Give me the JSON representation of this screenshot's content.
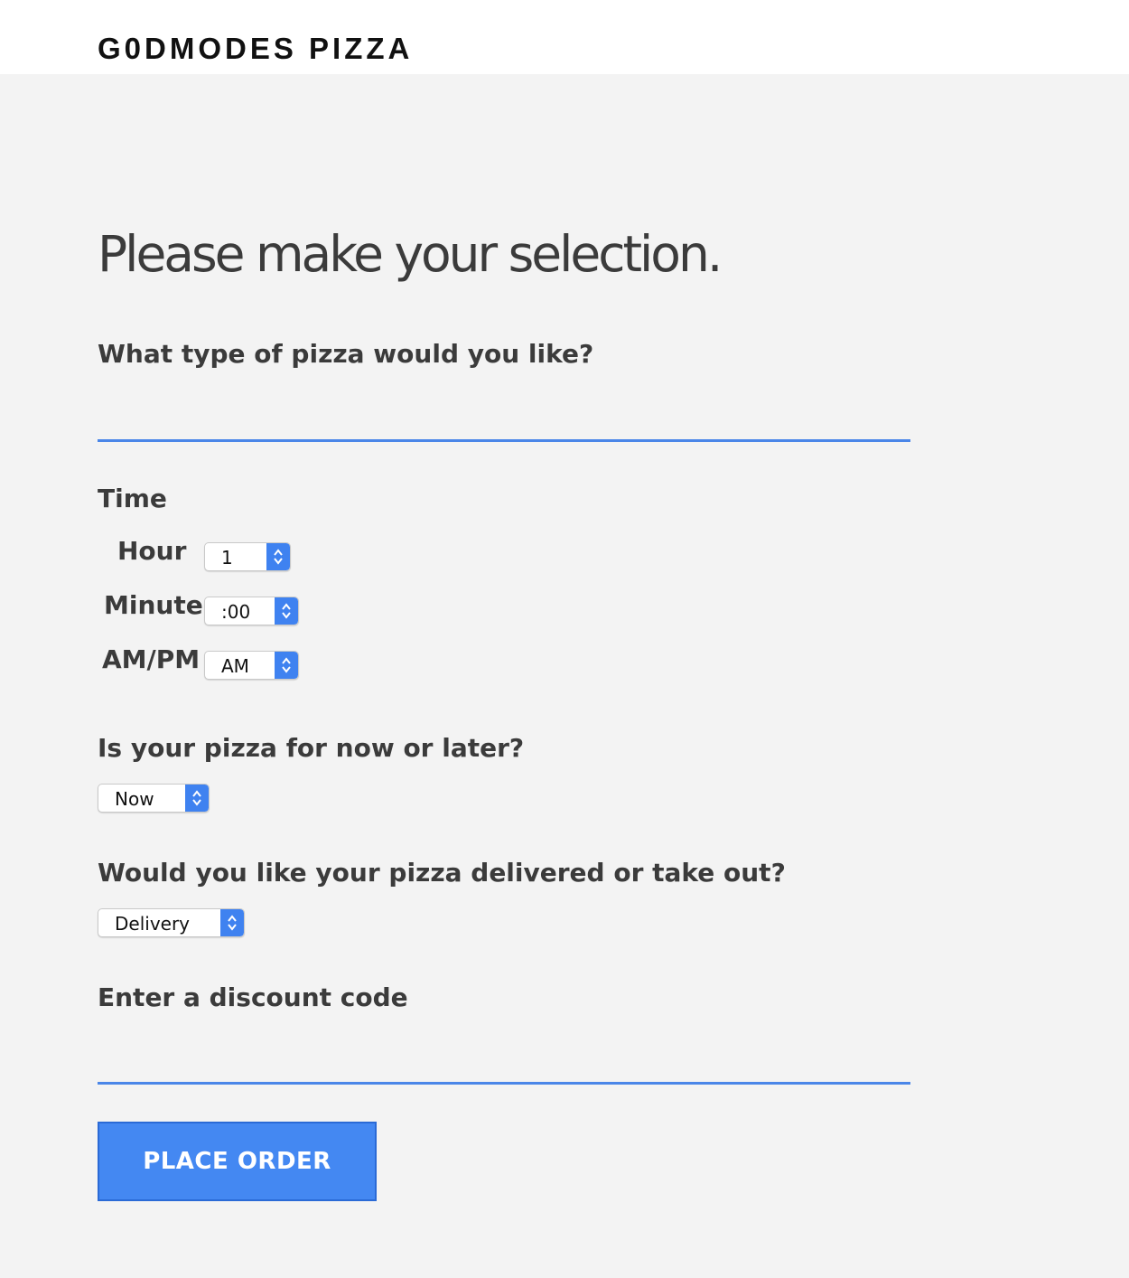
{
  "header": {
    "brand": "G0DMODES PIZZA"
  },
  "main": {
    "title": "Please make your selection.",
    "pizza_type": {
      "label": "What type of pizza would you like?",
      "value": ""
    },
    "time": {
      "label": "Time",
      "hour": {
        "label": "Hour",
        "value": "1"
      },
      "minute": {
        "label": "Minute",
        "value": ":00"
      },
      "ampm": {
        "label": "AM/PM",
        "value": "AM"
      }
    },
    "now_or_later": {
      "label": "Is your pizza for now or later?",
      "value": "Now"
    },
    "delivery": {
      "label": "Would you like your pizza delivered or take out?",
      "value": "Delivery"
    },
    "discount": {
      "label": "Enter a discount code",
      "value": ""
    },
    "submit_label": "PLACE ORDER"
  },
  "colors": {
    "accent": "#4488f2",
    "underline": "#4a86e8",
    "background": "#f3f3f3"
  },
  "icons": {
    "select_arrow": "chevron-up-down-icon"
  }
}
